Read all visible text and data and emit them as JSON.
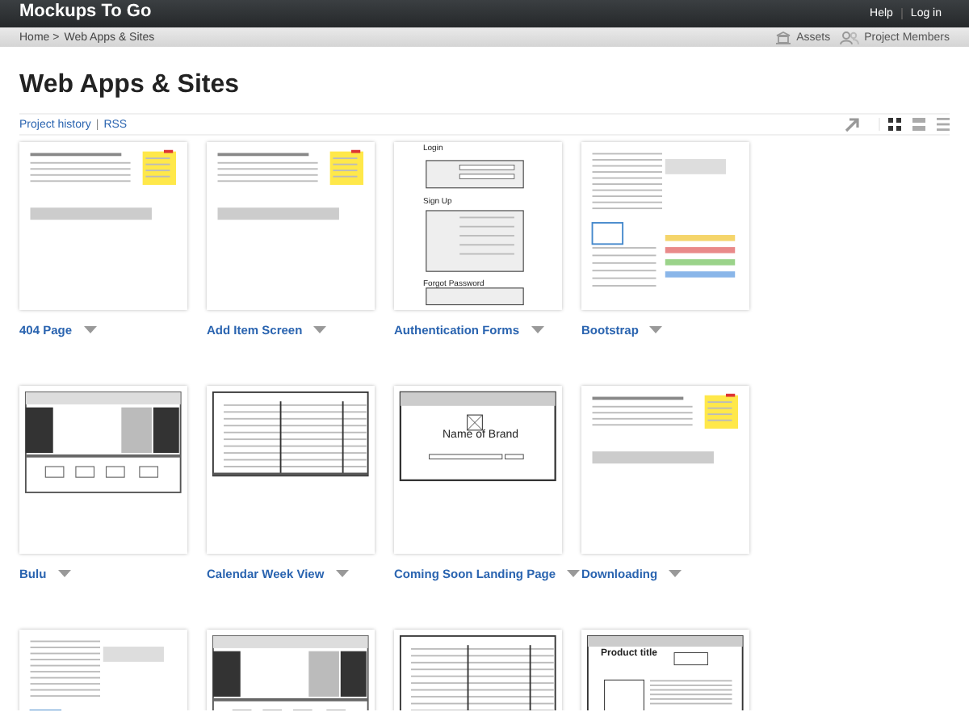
{
  "top_bar": {
    "brand": "Mockups To Go",
    "links": [
      "Help",
      "Log in"
    ]
  },
  "breadcrumb": {
    "items": [
      "Home >",
      "Web Apps & Sites"
    ],
    "actions": [
      "Assets",
      "Project Members"
    ]
  },
  "page": {
    "title": "Web Apps & Sites",
    "links": [
      "Project history",
      "RSS"
    ],
    "separator": "|"
  },
  "view_modes": [
    {
      "kind": "grid",
      "selected": true
    },
    {
      "kind": "list",
      "selected": false
    },
    {
      "kind": "compact",
      "selected": false
    }
  ],
  "mockups": [
    {
      "name": "404 Page",
      "kind": "note"
    },
    {
      "name": "Add Item Screen",
      "kind": "note"
    },
    {
      "name": "Authentication Forms",
      "kind": "forms",
      "texts": [
        "Login",
        "Sign Up",
        "Forgot Password"
      ]
    },
    {
      "name": "Bootstrap",
      "kind": "dense"
    },
    {
      "name": "Bulu",
      "kind": "browser"
    },
    {
      "name": "Calendar Week View",
      "kind": "calendar"
    },
    {
      "name": "Coming Soon Landing Page",
      "kind": "brand",
      "texts": [
        "Name of Brand"
      ]
    },
    {
      "name": "Downloading",
      "kind": "note"
    },
    {
      "kind": "dense"
    },
    {
      "kind": "browser"
    },
    {
      "kind": "calendar"
    },
    {
      "kind": "product",
      "texts": [
        "Product title"
      ]
    }
  ]
}
